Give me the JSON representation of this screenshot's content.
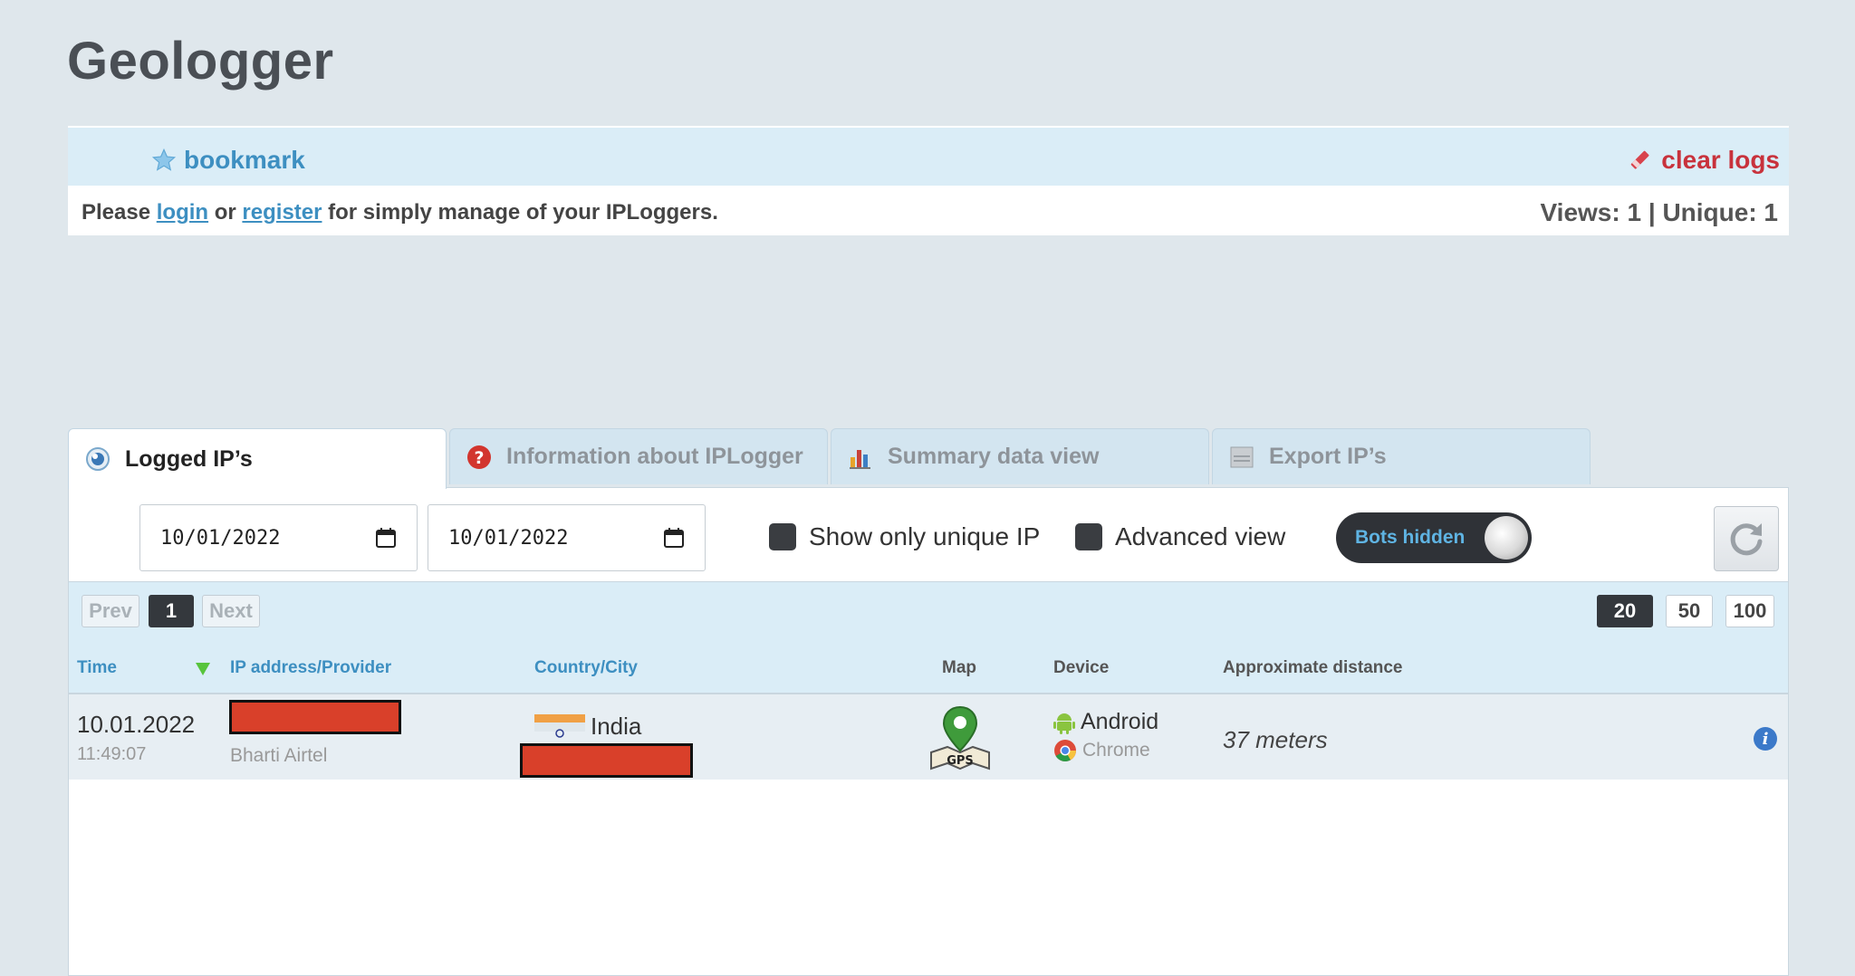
{
  "page_title": "Geologger",
  "topbar": {
    "bookmark_label": "bookmark",
    "clear_logs_label": "clear logs"
  },
  "infobar": {
    "msg_please": "Please",
    "login_label": "login",
    "msg_or": "or",
    "register_label": "register",
    "msg_rest": "for simply manage of your IPLoggers.",
    "views_text": "Views: 1 | Unique: 1"
  },
  "tabs": [
    {
      "label": "Logged IP’s",
      "icon": "eye-icon",
      "active": true
    },
    {
      "label": "Information about IPLogger",
      "icon": "question-icon",
      "active": false
    },
    {
      "label": "Summary data view",
      "icon": "bar-chart-icon",
      "active": false
    },
    {
      "label": "Export IP’s",
      "icon": "text-file-icon",
      "active": false
    }
  ],
  "filters": {
    "date_from": "10/01/2022",
    "date_to": "10/01/2022",
    "unique_ip_label": "Show only unique IP",
    "advanced_view_label": "Advanced view",
    "bots_toggle_label": "Bots hidden"
  },
  "pager": {
    "prev_label": "Prev",
    "current_page": "1",
    "next_label": "Next",
    "page_sizes": [
      "20",
      "50",
      "100"
    ],
    "selected_size": "20"
  },
  "table": {
    "columns": [
      "Time",
      "IP address/Provider",
      "Country/City",
      "Map",
      "Device",
      "Approximate distance"
    ],
    "rows": [
      {
        "date": "10.01.2022",
        "time": "11:49:07",
        "provider": "Bharti Airtel",
        "country": "India",
        "map_label": "GPS",
        "device": "Android",
        "browser": "Chrome",
        "distance": "37 meters"
      }
    ]
  },
  "colors": {
    "accent_blue": "#3d8fc1",
    "danger_red": "#c8323c",
    "redaction": "#d9402a"
  }
}
